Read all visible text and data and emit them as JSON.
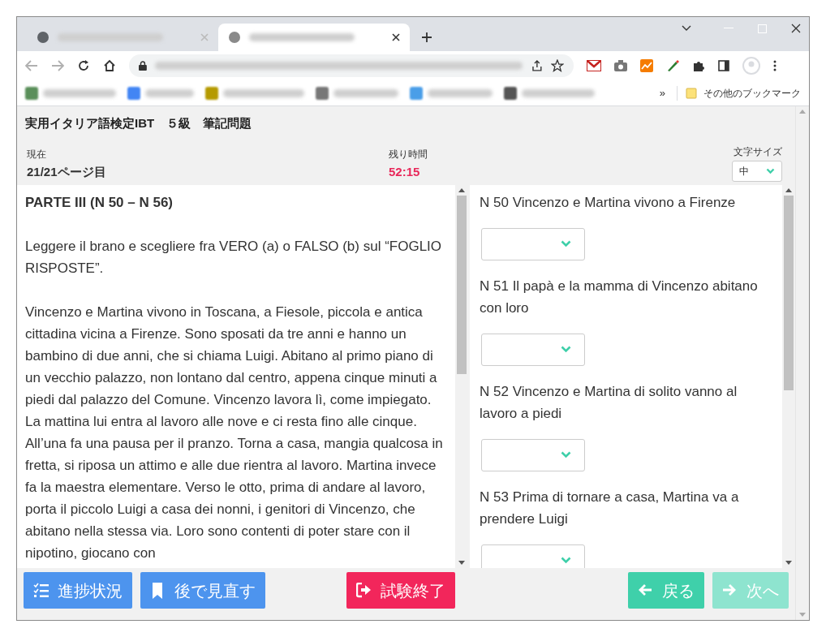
{
  "browser": {
    "tabs": [
      {
        "selected": false
      },
      {
        "selected": true
      }
    ],
    "bookmarks_overflow": "»",
    "other_bookmarks": "その他のブックマーク"
  },
  "exam": {
    "title": "実用イタリア語検定IBT　５級　筆記問題",
    "current_label": "現在",
    "current_value": "21/21ページ目",
    "time_label": "残り時間",
    "time_value": "52:15",
    "font_size_label": "文字サイズ",
    "font_size_value": "中"
  },
  "passage": {
    "heading": "PARTE III (N 50 – N 56)",
    "instruction": "Leggere il brano e scegliere fra VERO (a) o FALSO (b) sul “FOGLIO RISPOSTE”.",
    "text": "Vincenzo e Martina vivono in Toscana, a Fiesole, piccola e antica cittadina vicina a Firenze. Sono sposati da tre anni e hanno un bambino di due anni, che si chiama Luigi. Abitano al primo piano di un vecchio palazzo, non lontano dal centro, appena cinque minuti a piedi dal palazzo del Comune. Vincenzo lavora lì, come impiegato. La mattina lui entra al lavoro alle nove e ci resta fino alle cinque. All’una fa una pausa per il pranzo. Torna a casa, mangia qualcosa in fretta, si riposa un attimo e alle due rientra al lavoro. Martina invece fa la maestra elementare. Verso le otto, prima di andare al lavoro, porta il piccolo Luigi a casa dei nonni, i genitori di Vincenzo, che abitano nella stessa via. Loro sono contenti di poter stare con il nipotino, giocano con"
  },
  "questions": [
    {
      "text": "N 50 Vincenzo e Martina vivono a Firenze"
    },
    {
      "text": "N 51 Il papà e la mamma di Vincenzo abitano con loro"
    },
    {
      "text": "N 52 Vincenzo e Martina di solito vanno al lavoro a piedi"
    },
    {
      "text": "N 53 Prima di tornare a casa, Martina va a prendere Luigi"
    }
  ],
  "buttons": [
    {
      "kind": "progress",
      "label": "進捗状況",
      "disabled": false
    },
    {
      "kind": "bookmark",
      "label": "後で見直す",
      "disabled": false
    },
    {
      "kind": "finish",
      "label": "試験終了",
      "disabled": false
    },
    {
      "kind": "back",
      "label": "戻る",
      "disabled": false
    },
    {
      "kind": "next",
      "label": "次へ",
      "disabled": true
    }
  ]
}
